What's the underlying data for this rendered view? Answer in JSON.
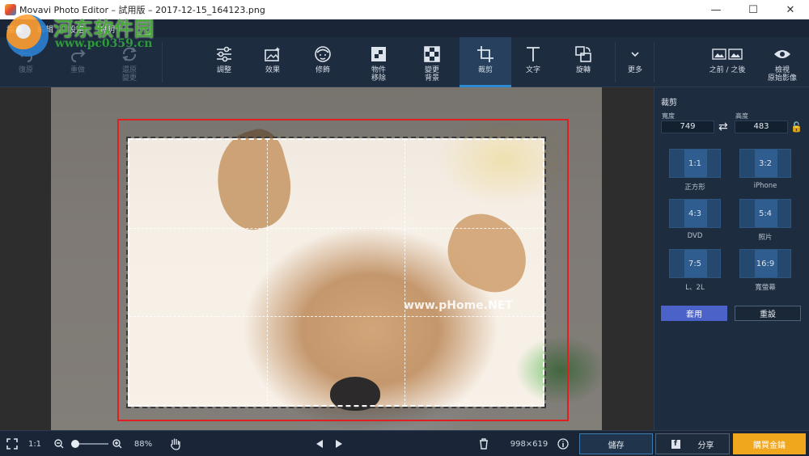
{
  "window": {
    "title": "Movavi Photo Editor – 試用版 – 2017-12-15_164123.png",
    "minimize": "—",
    "maximize": "☐",
    "close": "✕"
  },
  "menu": [
    "檔案",
    "編輯",
    "設定",
    "說明"
  ],
  "watermark": {
    "site_name": "河东软件园",
    "site_url": "www.pc0359.cn",
    "photo_watermark": "www.pHome.NET"
  },
  "toolbar": {
    "undo": "復原",
    "redo": "重做",
    "restore": "還原\n變更",
    "adjust": "調整",
    "effects": "效果",
    "retouch": "修飾",
    "object_removal": "物件\n移除",
    "change_bg": "變更\n背景",
    "crop": "裁剪",
    "text": "文字",
    "rotate": "旋轉",
    "more": "更多",
    "before_after": "之前 / 之後",
    "view_original": "檢視\n原始影像"
  },
  "crop_panel": {
    "title": "裁剪",
    "width_label": "寬度",
    "height_label": "高度",
    "width_value": "749",
    "height_value": "483",
    "ratios": [
      {
        "ratio": "1:1",
        "label": "正方形"
      },
      {
        "ratio": "3:2",
        "label": "iPhone"
      },
      {
        "ratio": "4:3",
        "label": "DVD"
      },
      {
        "ratio": "5:4",
        "label": "照片"
      },
      {
        "ratio": "7:5",
        "label": "L、2L"
      },
      {
        "ratio": "16:9",
        "label": "寬螢幕"
      }
    ],
    "apply": "套用",
    "reset": "重設"
  },
  "statusbar": {
    "actual_size": "1:1",
    "zoom_percent": "88%",
    "zoom_level": 0.1,
    "image_size": "998×619",
    "save": "儲存",
    "share": "分享",
    "buy": "購買金鑰"
  },
  "colors": {
    "accent": "#2d8bd6",
    "apply_button": "#4b63c9",
    "buy_button": "#f0a71e",
    "highlight_box": "#e02020"
  }
}
